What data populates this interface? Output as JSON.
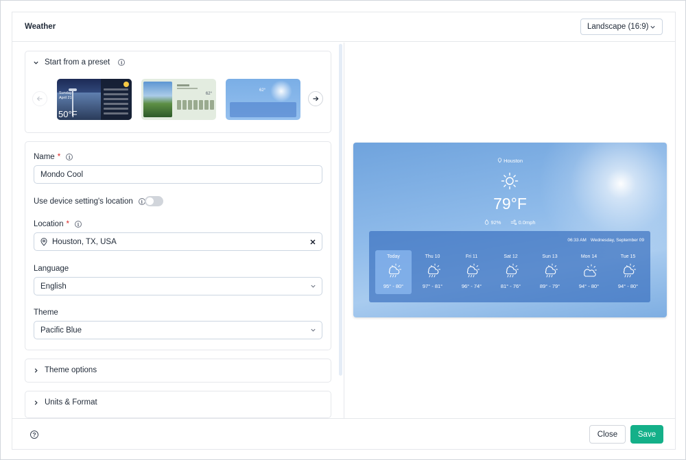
{
  "dialog": {
    "title": "Weather",
    "aspect_select": "Landscape (16:9)"
  },
  "presets": {
    "heading": "Start from a preset",
    "thumb1": {
      "date": "Sunday\nApril 21",
      "temp": "50°F"
    },
    "thumb2": {
      "temp": "62°"
    },
    "thumb3": {
      "temp": "62°"
    }
  },
  "form": {
    "name_label": "Name",
    "name_value": "Mondo Cool",
    "device_location_label": "Use device setting's location",
    "device_location_enabled": false,
    "location_label": "Location",
    "location_value": "Houston, TX, USA",
    "language_label": "Language",
    "language_value": "English",
    "theme_label": "Theme",
    "theme_value": "Pacific Blue",
    "required_mark": "*"
  },
  "sections": {
    "theme_options": "Theme options",
    "units_format": "Units & Format"
  },
  "preview": {
    "city": "Houston",
    "temperature": "79°F",
    "humidity": "92%",
    "wind": "0.0mph",
    "time": "06:33 AM",
    "date": "Wednesday, September 09",
    "days": [
      {
        "name": "Today",
        "range": "95° - 80°",
        "icon": "rain-sun-icon",
        "active": true
      },
      {
        "name": "Thu 10",
        "range": "97° - 81°",
        "icon": "rain-sun-icon",
        "active": false
      },
      {
        "name": "Fri 11",
        "range": "96° - 74°",
        "icon": "rain-sun-icon",
        "active": false
      },
      {
        "name": "Sat 12",
        "range": "81° - 76°",
        "icon": "rain-sun-icon",
        "active": false
      },
      {
        "name": "Sun 13",
        "range": "89° - 79°",
        "icon": "rain-sun-icon",
        "active": false
      },
      {
        "name": "Mon 14",
        "range": "94° - 80°",
        "icon": "partly-cloudy-icon",
        "active": false
      },
      {
        "name": "Tue 15",
        "range": "94° - 80°",
        "icon": "rain-sun-icon",
        "active": false
      }
    ]
  },
  "footer": {
    "help": "?",
    "close": "Close",
    "save": "Save"
  },
  "colors": {
    "save_button": "#14b089",
    "preview_sky": "#8fbbea",
    "forecast_panel": "#386ebe"
  }
}
